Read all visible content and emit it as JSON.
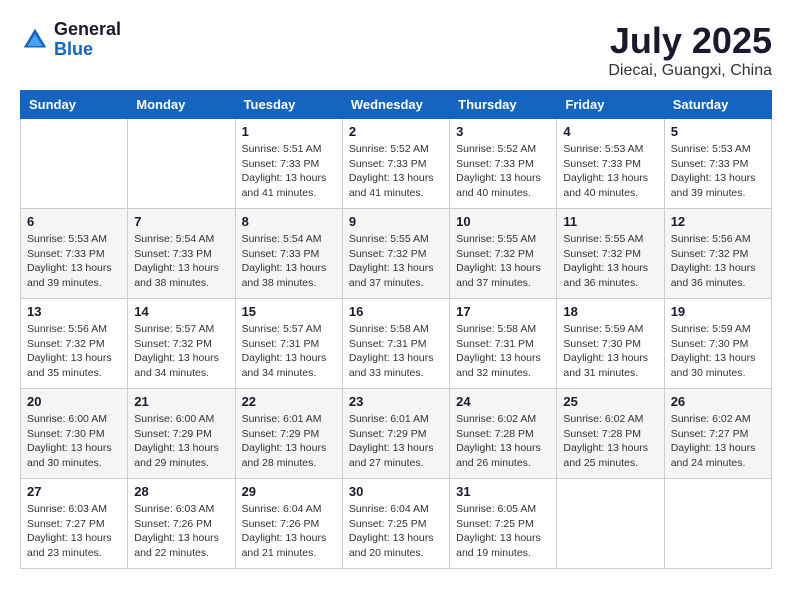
{
  "header": {
    "logo_general": "General",
    "logo_blue": "Blue",
    "month_title": "July 2025",
    "location": "Diecai, Guangxi, China"
  },
  "days_of_week": [
    "Sunday",
    "Monday",
    "Tuesday",
    "Wednesday",
    "Thursday",
    "Friday",
    "Saturday"
  ],
  "weeks": [
    {
      "days": [
        {
          "number": "",
          "info": ""
        },
        {
          "number": "",
          "info": ""
        },
        {
          "number": "1",
          "info": "Sunrise: 5:51 AM\nSunset: 7:33 PM\nDaylight: 13 hours and 41 minutes."
        },
        {
          "number": "2",
          "info": "Sunrise: 5:52 AM\nSunset: 7:33 PM\nDaylight: 13 hours and 41 minutes."
        },
        {
          "number": "3",
          "info": "Sunrise: 5:52 AM\nSunset: 7:33 PM\nDaylight: 13 hours and 40 minutes."
        },
        {
          "number": "4",
          "info": "Sunrise: 5:53 AM\nSunset: 7:33 PM\nDaylight: 13 hours and 40 minutes."
        },
        {
          "number": "5",
          "info": "Sunrise: 5:53 AM\nSunset: 7:33 PM\nDaylight: 13 hours and 39 minutes."
        }
      ]
    },
    {
      "days": [
        {
          "number": "6",
          "info": "Sunrise: 5:53 AM\nSunset: 7:33 PM\nDaylight: 13 hours and 39 minutes."
        },
        {
          "number": "7",
          "info": "Sunrise: 5:54 AM\nSunset: 7:33 PM\nDaylight: 13 hours and 38 minutes."
        },
        {
          "number": "8",
          "info": "Sunrise: 5:54 AM\nSunset: 7:33 PM\nDaylight: 13 hours and 38 minutes."
        },
        {
          "number": "9",
          "info": "Sunrise: 5:55 AM\nSunset: 7:32 PM\nDaylight: 13 hours and 37 minutes."
        },
        {
          "number": "10",
          "info": "Sunrise: 5:55 AM\nSunset: 7:32 PM\nDaylight: 13 hours and 37 minutes."
        },
        {
          "number": "11",
          "info": "Sunrise: 5:55 AM\nSunset: 7:32 PM\nDaylight: 13 hours and 36 minutes."
        },
        {
          "number": "12",
          "info": "Sunrise: 5:56 AM\nSunset: 7:32 PM\nDaylight: 13 hours and 36 minutes."
        }
      ]
    },
    {
      "days": [
        {
          "number": "13",
          "info": "Sunrise: 5:56 AM\nSunset: 7:32 PM\nDaylight: 13 hours and 35 minutes."
        },
        {
          "number": "14",
          "info": "Sunrise: 5:57 AM\nSunset: 7:32 PM\nDaylight: 13 hours and 34 minutes."
        },
        {
          "number": "15",
          "info": "Sunrise: 5:57 AM\nSunset: 7:31 PM\nDaylight: 13 hours and 34 minutes."
        },
        {
          "number": "16",
          "info": "Sunrise: 5:58 AM\nSunset: 7:31 PM\nDaylight: 13 hours and 33 minutes."
        },
        {
          "number": "17",
          "info": "Sunrise: 5:58 AM\nSunset: 7:31 PM\nDaylight: 13 hours and 32 minutes."
        },
        {
          "number": "18",
          "info": "Sunrise: 5:59 AM\nSunset: 7:30 PM\nDaylight: 13 hours and 31 minutes."
        },
        {
          "number": "19",
          "info": "Sunrise: 5:59 AM\nSunset: 7:30 PM\nDaylight: 13 hours and 30 minutes."
        }
      ]
    },
    {
      "days": [
        {
          "number": "20",
          "info": "Sunrise: 6:00 AM\nSunset: 7:30 PM\nDaylight: 13 hours and 30 minutes."
        },
        {
          "number": "21",
          "info": "Sunrise: 6:00 AM\nSunset: 7:29 PM\nDaylight: 13 hours and 29 minutes."
        },
        {
          "number": "22",
          "info": "Sunrise: 6:01 AM\nSunset: 7:29 PM\nDaylight: 13 hours and 28 minutes."
        },
        {
          "number": "23",
          "info": "Sunrise: 6:01 AM\nSunset: 7:29 PM\nDaylight: 13 hours and 27 minutes."
        },
        {
          "number": "24",
          "info": "Sunrise: 6:02 AM\nSunset: 7:28 PM\nDaylight: 13 hours and 26 minutes."
        },
        {
          "number": "25",
          "info": "Sunrise: 6:02 AM\nSunset: 7:28 PM\nDaylight: 13 hours and 25 minutes."
        },
        {
          "number": "26",
          "info": "Sunrise: 6:02 AM\nSunset: 7:27 PM\nDaylight: 13 hours and 24 minutes."
        }
      ]
    },
    {
      "days": [
        {
          "number": "27",
          "info": "Sunrise: 6:03 AM\nSunset: 7:27 PM\nDaylight: 13 hours and 23 minutes."
        },
        {
          "number": "28",
          "info": "Sunrise: 6:03 AM\nSunset: 7:26 PM\nDaylight: 13 hours and 22 minutes."
        },
        {
          "number": "29",
          "info": "Sunrise: 6:04 AM\nSunset: 7:26 PM\nDaylight: 13 hours and 21 minutes."
        },
        {
          "number": "30",
          "info": "Sunrise: 6:04 AM\nSunset: 7:25 PM\nDaylight: 13 hours and 20 minutes."
        },
        {
          "number": "31",
          "info": "Sunrise: 6:05 AM\nSunset: 7:25 PM\nDaylight: 13 hours and 19 minutes."
        },
        {
          "number": "",
          "info": ""
        },
        {
          "number": "",
          "info": ""
        }
      ]
    }
  ]
}
